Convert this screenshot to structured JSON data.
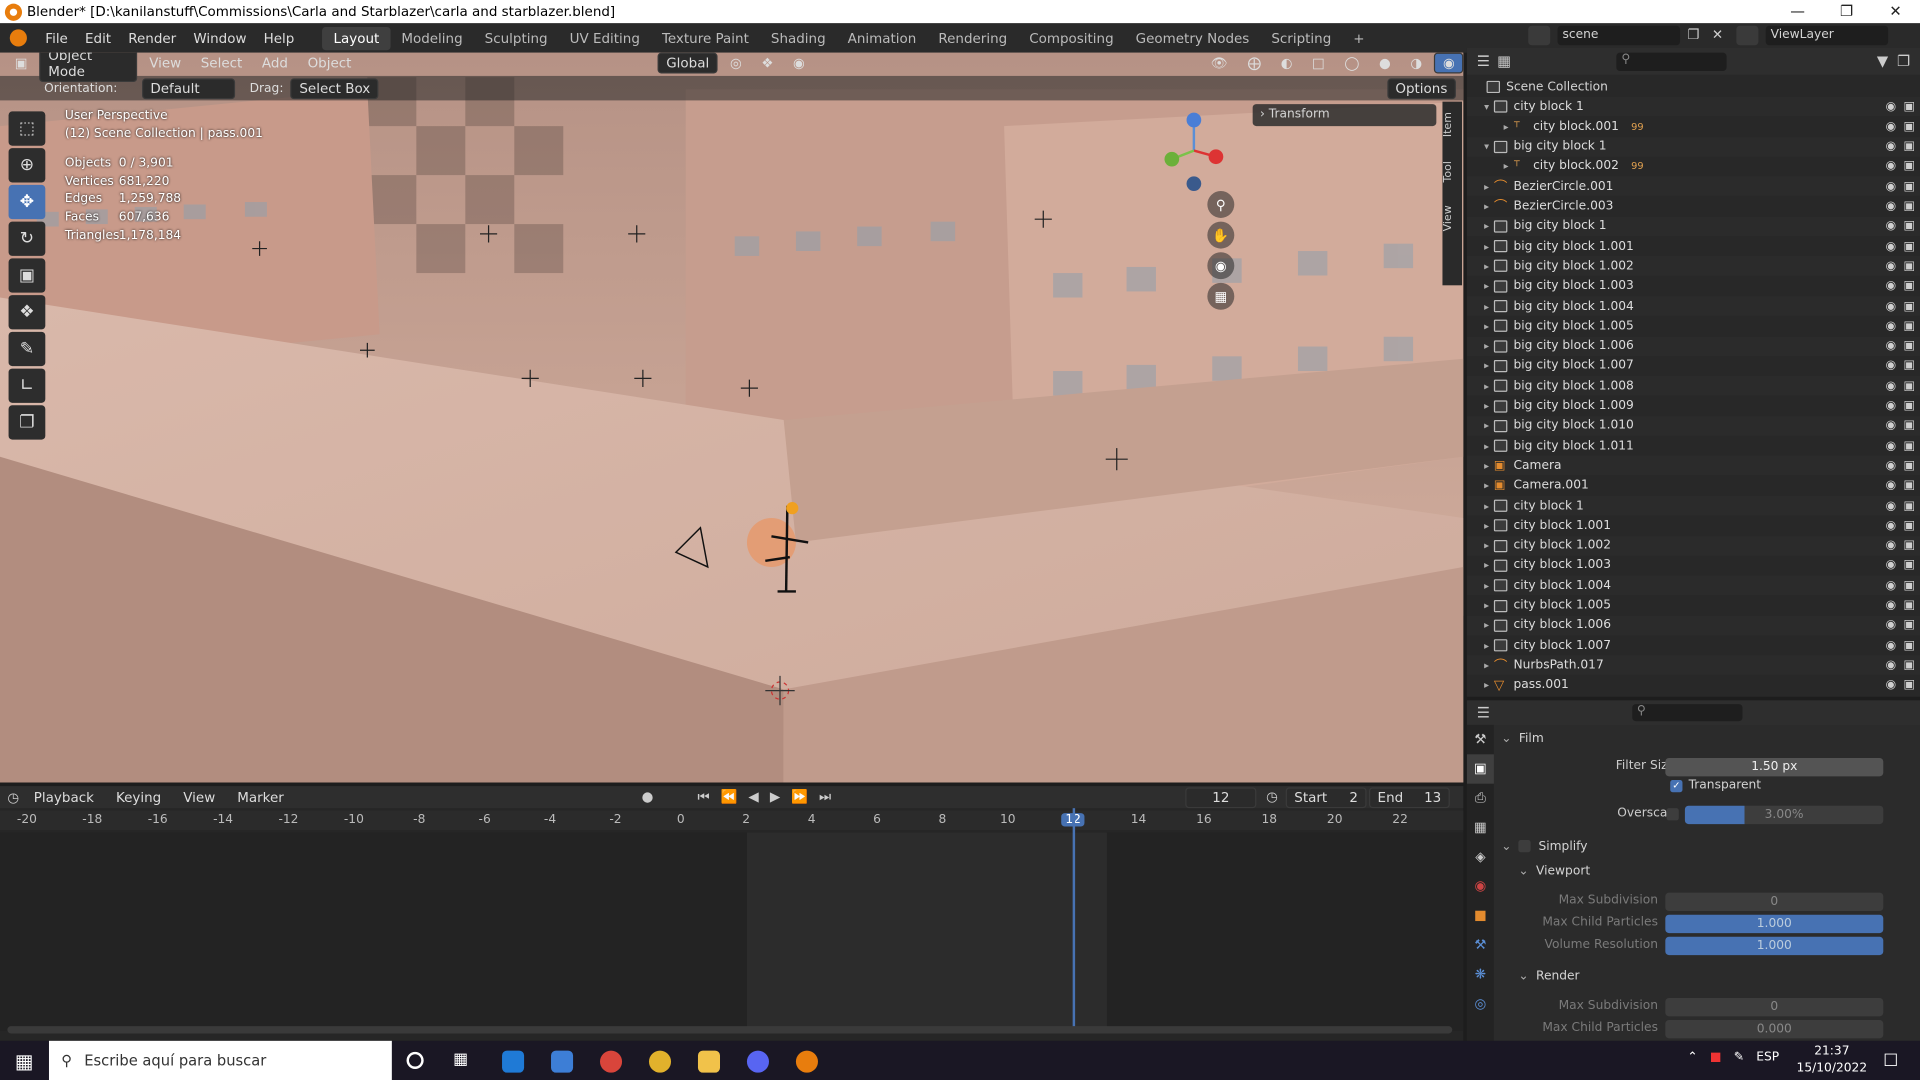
{
  "titlebar": {
    "title": "Blender* [D:\\kanilanstuff\\Commissions\\Carla and Starblazer\\carla and starblazer.blend]"
  },
  "menu": {
    "items": [
      "File",
      "Edit",
      "Render",
      "Window",
      "Help"
    ]
  },
  "workspaces": [
    "Layout",
    "Modeling",
    "Sculpting",
    "UV Editing",
    "Texture Paint",
    "Shading",
    "Animation",
    "Rendering",
    "Compositing",
    "Geometry Nodes",
    "Scripting",
    "+"
  ],
  "scene": {
    "label": "scene",
    "view_layer": "ViewLayer"
  },
  "viewport": {
    "mode": "Object Mode",
    "menus": [
      "View",
      "Select",
      "Add",
      "Object"
    ],
    "transform_orientation": "Global",
    "orientation_label": "Orientation:",
    "orientation_value": "Default",
    "drag_label": "Drag:",
    "drag_value": "Select Box",
    "options": "Options",
    "perspective": "User Perspective",
    "collection_info": "(12) Scene Collection | pass.001",
    "stats": [
      {
        "label": "Objects",
        "value": "0 / 3,901"
      },
      {
        "label": "Vertices",
        "value": "681,220"
      },
      {
        "label": "Edges",
        "value": "1,259,788"
      },
      {
        "label": "Faces",
        "value": "607,636"
      },
      {
        "label": "Triangles",
        "value": "1,178,184"
      }
    ],
    "transform_panel": "Transform",
    "side_tabs": [
      "Item",
      "Tool",
      "View"
    ]
  },
  "outliner": {
    "root": "Scene Collection",
    "rows": [
      {
        "name": "city block 1",
        "type": "collection",
        "indent": 1
      },
      {
        "name": "city block.001",
        "type": "empty",
        "indent": 2,
        "badge": "99"
      },
      {
        "name": "big city block 1",
        "type": "collection",
        "indent": 1
      },
      {
        "name": "city block.002",
        "type": "empty",
        "indent": 2,
        "badge": "99"
      },
      {
        "name": "BezierCircle.001",
        "type": "curve",
        "indent": 1
      },
      {
        "name": "BezierCircle.003",
        "type": "curve",
        "indent": 1
      },
      {
        "name": "big city block 1",
        "type": "collection",
        "indent": 1
      },
      {
        "name": "big city block 1.001",
        "type": "collection",
        "indent": 1
      },
      {
        "name": "big city block 1.002",
        "type": "collection",
        "indent": 1
      },
      {
        "name": "big city block 1.003",
        "type": "collection",
        "indent": 1
      },
      {
        "name": "big city block 1.004",
        "type": "collection",
        "indent": 1
      },
      {
        "name": "big city block 1.005",
        "type": "collection",
        "indent": 1
      },
      {
        "name": "big city block 1.006",
        "type": "collection",
        "indent": 1
      },
      {
        "name": "big city block 1.007",
        "type": "collection",
        "indent": 1
      },
      {
        "name": "big city block 1.008",
        "type": "collection",
        "indent": 1
      },
      {
        "name": "big city block 1.009",
        "type": "collection",
        "indent": 1
      },
      {
        "name": "big city block 1.010",
        "type": "collection",
        "indent": 1
      },
      {
        "name": "big city block 1.011",
        "type": "collection",
        "indent": 1
      },
      {
        "name": "Camera",
        "type": "camera",
        "indent": 1
      },
      {
        "name": "Camera.001",
        "type": "camera",
        "indent": 1
      },
      {
        "name": "city block 1",
        "type": "collection",
        "indent": 1
      },
      {
        "name": "city block 1.001",
        "type": "collection",
        "indent": 1
      },
      {
        "name": "city block 1.002",
        "type": "collection",
        "indent": 1
      },
      {
        "name": "city block 1.003",
        "type": "collection",
        "indent": 1
      },
      {
        "name": "city block 1.004",
        "type": "collection",
        "indent": 1
      },
      {
        "name": "city block 1.005",
        "type": "collection",
        "indent": 1
      },
      {
        "name": "city block 1.006",
        "type": "collection",
        "indent": 1
      },
      {
        "name": "city block 1.007",
        "type": "collection",
        "indent": 1
      },
      {
        "name": "NurbsPath.017",
        "type": "curve",
        "indent": 1
      },
      {
        "name": "pass.001",
        "type": "mesh",
        "indent": 1
      }
    ]
  },
  "properties": {
    "film": "Film",
    "filter_size_label": "Filter Size",
    "filter_size": "1.50 px",
    "transparent": "Transparent",
    "overscan_label": "Overscan",
    "overscan": "3.00%",
    "simplify": "Simplify",
    "viewport": "Viewport",
    "render": "Render",
    "max_subdivision_label": "Max Subdivision",
    "max_subdivision": "0",
    "max_child_particles_label": "Max Child Particles",
    "max_child_particles": "1.000",
    "volume_resolution_label": "Volume Resolution",
    "volume_resolution": "1.000",
    "render_max_subdivision": "0",
    "render_max_child_particles": "0.000"
  },
  "timeline": {
    "menus": [
      "Playback",
      "Keying",
      "View",
      "Marker"
    ],
    "current_frame": "12",
    "start_label": "Start",
    "start": "2",
    "end_label": "End",
    "end": "13",
    "ticks": [
      "-20",
      "-18",
      "-16",
      "-14",
      "-12",
      "-10",
      "-8",
      "-6",
      "-4",
      "-2",
      "0",
      "2",
      "4",
      "6",
      "8",
      "10",
      "12",
      "14",
      "16",
      "18",
      "20",
      "22"
    ]
  },
  "taskbar": {
    "search_placeholder": "Escribe aquí para buscar",
    "language": "ESP",
    "time": "21:37",
    "date": "15/10/2022"
  },
  "colors": {
    "accent": "#4772b3",
    "orange": "#e87d0d"
  }
}
